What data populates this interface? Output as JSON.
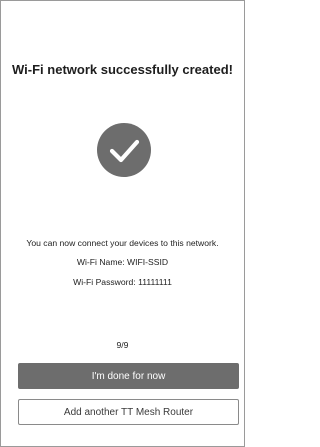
{
  "screen": {
    "title": "Wi-Fi network successfully created!",
    "status_icon": "checkmark-circle-icon",
    "message": "You can now connect your devices to this network.",
    "wifi_name": "Wi-Fi Name: WIFI-SSID",
    "wifi_password": "Wi-Fi Password: 11111111",
    "page_indicator": "9/9"
  },
  "actions": {
    "done_label": "I'm done for now",
    "add_router_label": "Add another TT Mesh Router"
  },
  "colors": {
    "check_circle": "#6d6d6d",
    "primary_button": "#6d6d6d",
    "secondary_border": "#8a8a8a"
  }
}
